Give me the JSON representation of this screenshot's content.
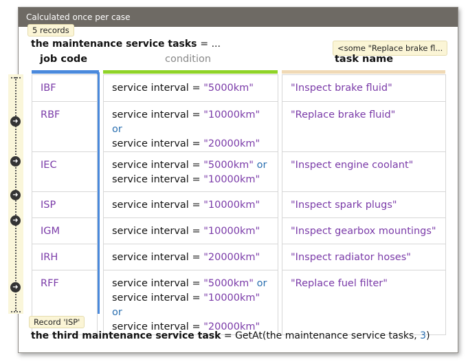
{
  "header": {
    "title": "Calculated once per case"
  },
  "records_badge": "5 records",
  "definition": {
    "name": "the maintenance service tasks",
    "operator": "= ..."
  },
  "tooltip": "<some \"Replace brake fl...",
  "columns": {
    "code": "job code",
    "condition": "condition",
    "task": "task name"
  },
  "colors": {
    "code_bar": "#4a89dc",
    "condition_bar": "#8fd327",
    "task_bar": "#f0d9b5"
  },
  "rows": [
    {
      "code": "IBF",
      "conditions": [
        "service interval = \"5000km\""
      ],
      "task": "\"Inspect brake fluid\""
    },
    {
      "code": "RBF",
      "conditions": [
        "service interval = \"10000km\" or",
        "service interval = \"20000km\""
      ],
      "task": "\"Replace brake fluid\""
    },
    {
      "code": "IEC",
      "conditions": [
        "service interval = \"5000km\" or",
        "service interval = \"10000km\""
      ],
      "task": "\"Inspect engine coolant\""
    },
    {
      "code": "ISP",
      "conditions": [
        "service interval = \"10000km\""
      ],
      "task": "\"Inspect spark plugs\""
    },
    {
      "code": "IGM",
      "conditions": [
        "service interval = \"10000km\""
      ],
      "task": "\"Inspect gearbox mountings\""
    },
    {
      "code": "IRH",
      "conditions": [
        "service interval = \"20000km\""
      ],
      "task": "\"Inspect radiator hoses\""
    },
    {
      "code": "RFF",
      "conditions": [
        "service interval = \"5000km\" or",
        "service interval = \"10000km\" or",
        "service interval = \"20000km\""
      ],
      "task": "\"Replace fuel filter\""
    }
  ],
  "nav_icon": "arrow-right-circle-icon",
  "record_badge": "Record 'ISP'",
  "result": {
    "name": "the third maintenance service task",
    "operator": "=",
    "fn": "GetAt(",
    "arg": "the maintenance service tasks, ",
    "index": "3",
    "close": ")"
  }
}
